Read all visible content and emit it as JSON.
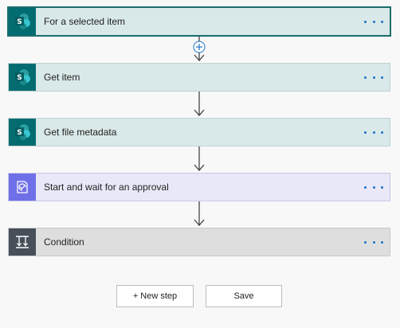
{
  "steps": [
    {
      "label": "For a selected item",
      "icon": "sharepoint-icon"
    },
    {
      "label": "Get item",
      "icon": "sharepoint-icon"
    },
    {
      "label": "Get file metadata",
      "icon": "sharepoint-icon"
    },
    {
      "label": "Start and wait for an approval",
      "icon": "approval-icon"
    },
    {
      "label": "Condition",
      "icon": "condition-icon"
    }
  ],
  "footer": {
    "new_step_label": "+ New step",
    "save_label": "Save"
  },
  "colors": {
    "sharepoint": "#036c70",
    "approval": "#6f6fe8",
    "condition": "#474f59",
    "more_dots": "#1d72c8"
  }
}
